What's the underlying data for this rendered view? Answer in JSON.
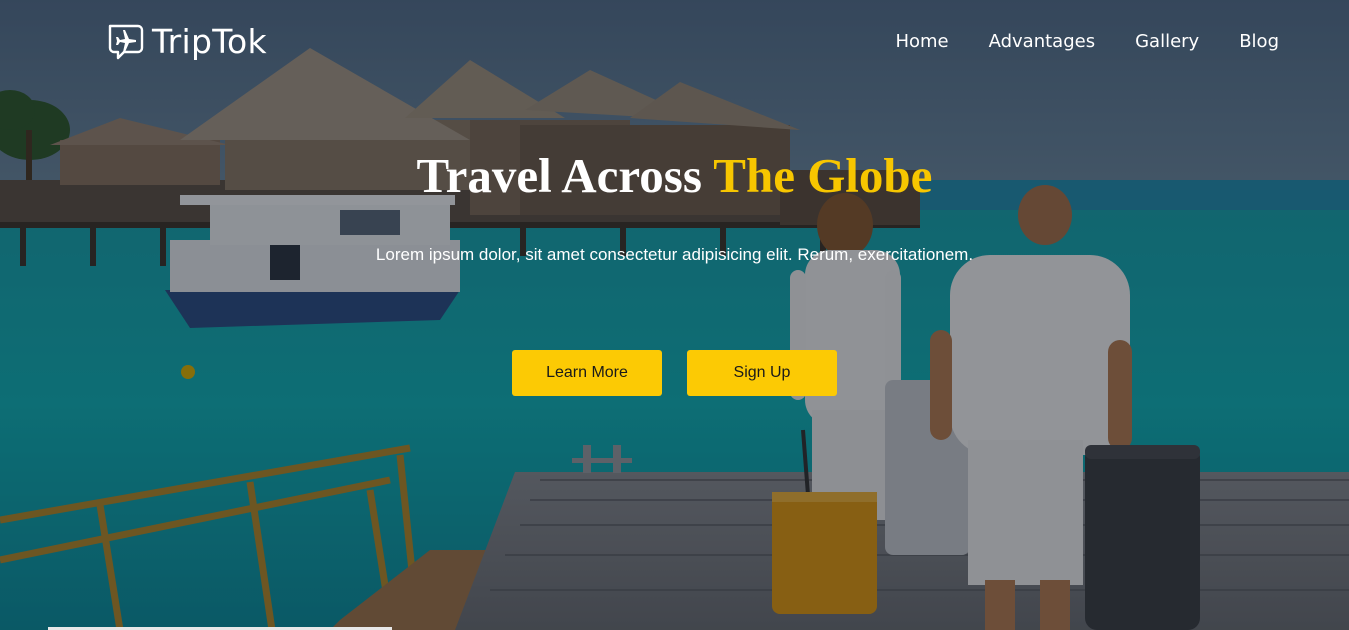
{
  "brand": {
    "name": "TripTok",
    "logo_icon": "airplane-speech-bubble-icon"
  },
  "nav": {
    "items": [
      {
        "label": "Home"
      },
      {
        "label": "Advantages"
      },
      {
        "label": "Gallery"
      },
      {
        "label": "Blog"
      }
    ]
  },
  "hero": {
    "headline_part1": "Travel Across ",
    "headline_part2": "The Globe",
    "subtitle": "Lorem ipsum dolor, sit amet consectetur adipisicing elit. Rerum, exercitationem.",
    "learn_more_label": "Learn More",
    "sign_up_label": "Sign Up"
  },
  "colors": {
    "accent": "#fcca04",
    "text": "#ffffff"
  }
}
